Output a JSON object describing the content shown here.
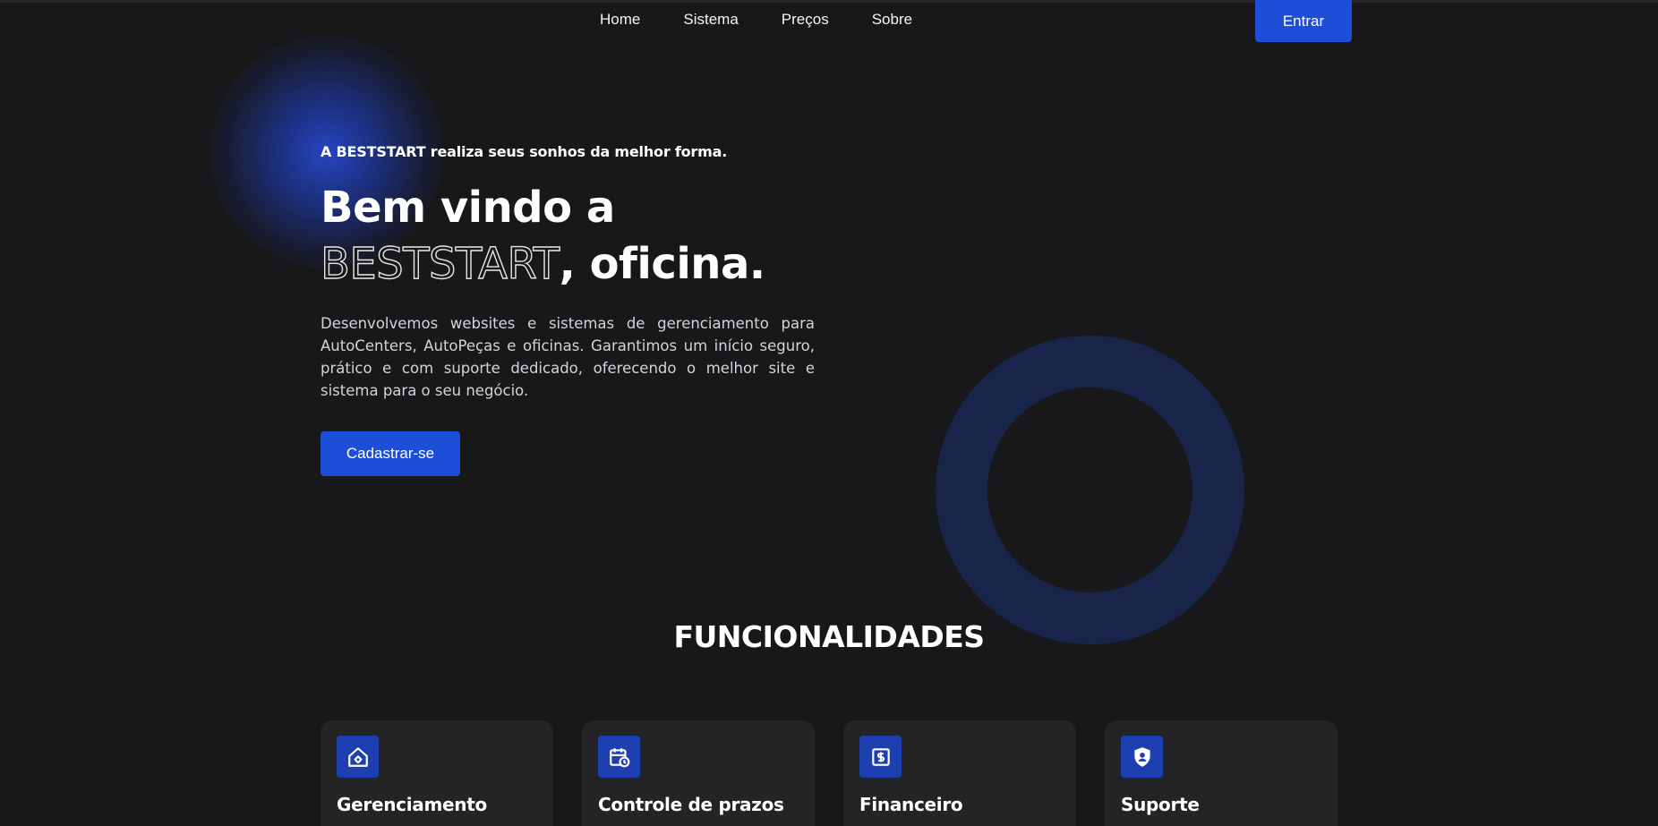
{
  "nav": {
    "links": [
      "Home",
      "Sistema",
      "Preços",
      "Sobre"
    ],
    "login_label": "Entrar"
  },
  "hero": {
    "eyebrow": "A BESTSTART realiza seus sonhos da melhor forma.",
    "title_line1": "Bem vindo a",
    "title_outline": "BESTSTART",
    "title_rest": ", oficina.",
    "description": "Desenvolvemos websites e sistemas de gerenciamento para AutoCenters, AutoPeças e oficinas. Garantimos um início seguro, prático e com suporte dedicado, oferecendo o melhor site e sistema para o seu negócio.",
    "cta_label": "Cadastrar-se"
  },
  "features": {
    "title": "FUNCIONALIDADES",
    "cards": [
      {
        "title": "Gerenciamento",
        "icon": "house-gear-icon"
      },
      {
        "title": "Controle de prazos",
        "icon": "calendar-clock-icon"
      },
      {
        "title": "Financeiro",
        "icon": "dollar-receipt-icon"
      },
      {
        "title": "Suporte",
        "icon": "shield-user-icon"
      }
    ]
  },
  "colors": {
    "background": "#18181b",
    "card": "#242427",
    "accent": "#1d4ed8",
    "decor": "#182449"
  }
}
